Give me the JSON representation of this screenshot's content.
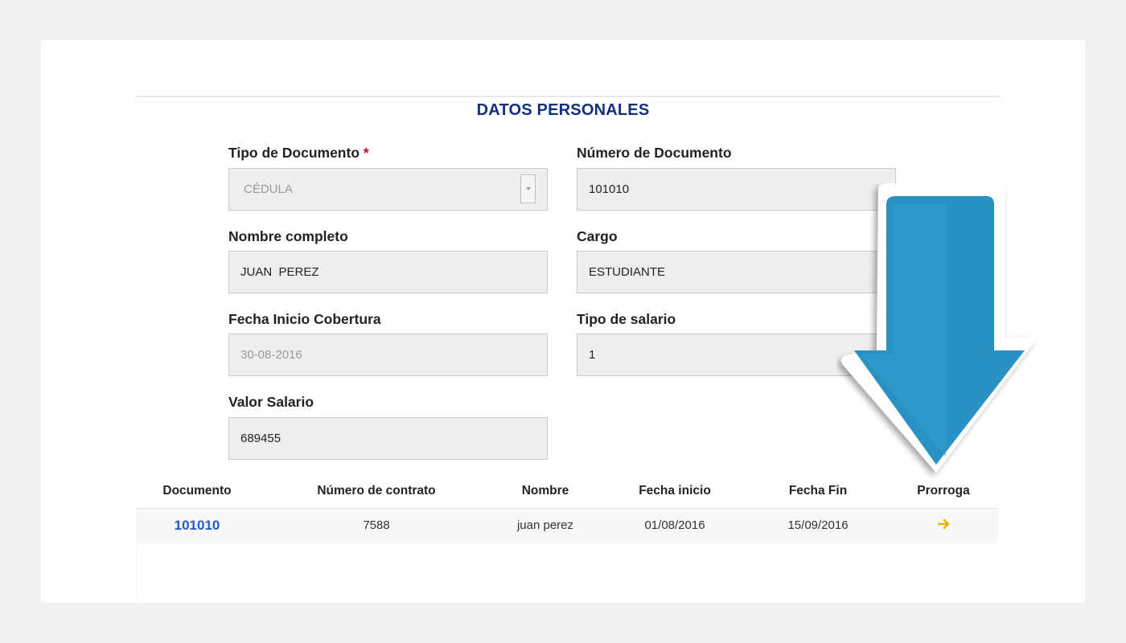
{
  "section": {
    "title": "DATOS PERSONALES"
  },
  "form": {
    "tipo_documento": {
      "label": "Tipo de Documento",
      "required_mark": "*",
      "value": "CÉDULA"
    },
    "numero_documento": {
      "label": "Número de Documento",
      "value": "101010"
    },
    "nombre_completo": {
      "label": "Nombre completo",
      "value": "JUAN  PEREZ"
    },
    "cargo": {
      "label": "Cargo",
      "value": "ESTUDIANTE"
    },
    "fecha_inicio_cobertura": {
      "label": "Fecha Inicio Cobertura",
      "value": "30-08-2016"
    },
    "tipo_salario": {
      "label": "Tipo de salario",
      "value": "1"
    },
    "valor_salario": {
      "label": "Valor Salario",
      "value": "689455"
    }
  },
  "table": {
    "headers": [
      "Documento",
      "Número de contrato",
      "Nombre",
      "Fecha inicio",
      "Fecha Fin",
      "Prorroga"
    ],
    "rows": [
      {
        "documento": "101010",
        "contrato": "7588",
        "nombre": "juan perez",
        "fecha_inicio": "01/08/2016",
        "fecha_fin": "15/09/2016",
        "prorroga_icon": "arrow-right-icon"
      }
    ]
  },
  "colors": {
    "title": "#14307a",
    "link": "#1f5cc5",
    "required": "#d0021b",
    "prorroga_arrow": "#f0b400",
    "callout_arrow": "#2a91c4"
  },
  "overlay": {
    "icon": "down-arrow-callout-icon"
  }
}
